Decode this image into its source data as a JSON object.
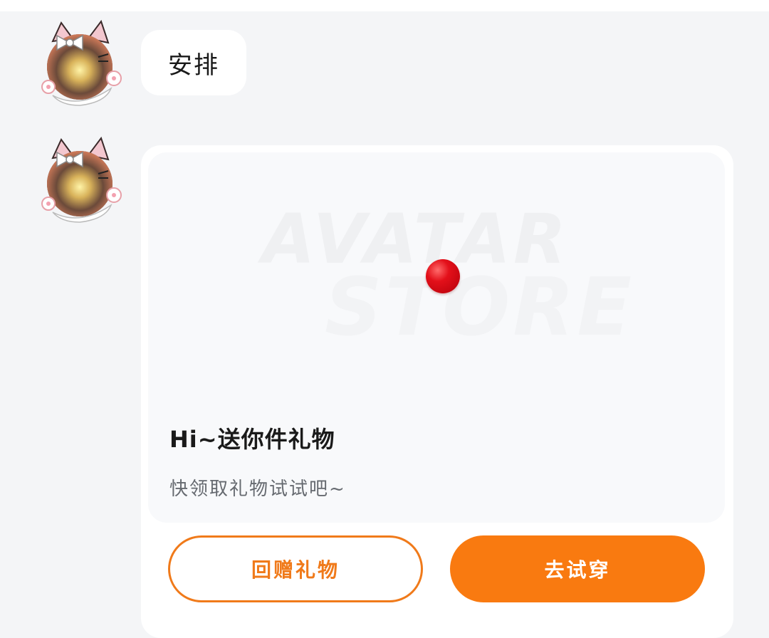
{
  "messages": [
    {
      "type": "text",
      "text": "安排"
    },
    {
      "type": "gift_card",
      "banner": {
        "watermark_line1": "AVATAR",
        "watermark_line2": "STORE"
      },
      "title": "Hi~送你件礼物",
      "subtitle": "快领取礼物试试吧~",
      "buttons": {
        "return_gift": "回赠礼物",
        "try_on": "去试穿"
      }
    }
  ],
  "colors": {
    "accent": "#f97a10",
    "background": "#f4f5f7",
    "card": "#ffffff"
  },
  "icons": {
    "avatar": "cat-ear-avatar-icon",
    "indicator": "red-dot-icon"
  }
}
